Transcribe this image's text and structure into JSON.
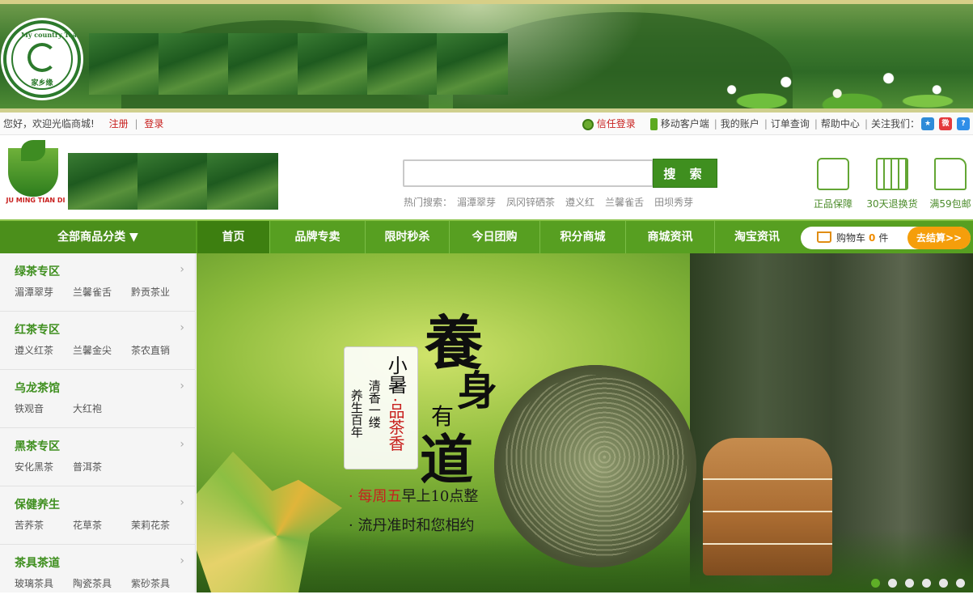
{
  "banner": {
    "logo_ring_text": "My country Tea",
    "logo_brand": "家乡缘"
  },
  "topbar": {
    "welcome": "您好，欢迎光临商城!",
    "register": "注册",
    "sep": "|",
    "login": "登录",
    "trust_login": "信任登录",
    "mobile": "移动客户端",
    "account": "我的账户",
    "orders": "订单查询",
    "help": "帮助中心",
    "follow": "关注我们："
  },
  "header": {
    "logo_text": "JU MING TIAN DI",
    "search_placeholder": "",
    "search_button": "搜 索",
    "hot_label": "热门搜索：",
    "hot_terms": [
      "湄潭翠芽",
      "凤冈锌硒茶",
      "遵义红",
      "兰馨雀舌",
      "田坝秀芽"
    ],
    "services": [
      "正品保障",
      "30天退换货",
      "满59包邮"
    ]
  },
  "nav": {
    "categories": "全部商品分类 ▼",
    "items": [
      "首页",
      "品牌专卖",
      "限时秒杀",
      "今日团购",
      "积分商城",
      "商城资讯",
      "淘宝资讯"
    ],
    "cart_label": "购物车",
    "cart_count": "0",
    "cart_unit": "件",
    "checkout": "去结算>>"
  },
  "sidebar": {
    "categories": [
      {
        "title": "绿茶专区",
        "subs": [
          "湄潭翠芽",
          "兰馨雀舌",
          "黔贡茶业"
        ]
      },
      {
        "title": "红茶专区",
        "subs": [
          "遵义红茶",
          "兰馨金尖",
          "茶农直销"
        ]
      },
      {
        "title": "乌龙茶馆",
        "subs": [
          "铁观音",
          "大红袍"
        ]
      },
      {
        "title": "黑茶专区",
        "subs": [
          "安化黑茶",
          "普洱茶"
        ]
      },
      {
        "title": "保健养生",
        "subs": [
          "苦荞茶",
          "花草茶",
          "茉莉花茶"
        ]
      },
      {
        "title": "茶具茶道",
        "subs": [
          "玻璃茶具",
          "陶瓷茶具",
          "紫砂茶具"
        ]
      }
    ]
  },
  "hero": {
    "label_1": "小暑",
    "label_2": "·品茶香",
    "label_3": "清香一缕",
    "label_4": "养生百年",
    "big_1": "養",
    "big_2": "身",
    "big_3": "有",
    "big_4": "道",
    "line1_pre": "· 每周五",
    "line1_post": "早上10点整",
    "line2": "· 流丹准时和您相约",
    "slides": 6,
    "active_slide": 1
  },
  "colors": {
    "brand_green": "#579f21",
    "accent_orange": "#f59e0b",
    "link_red": "#c8201e"
  }
}
